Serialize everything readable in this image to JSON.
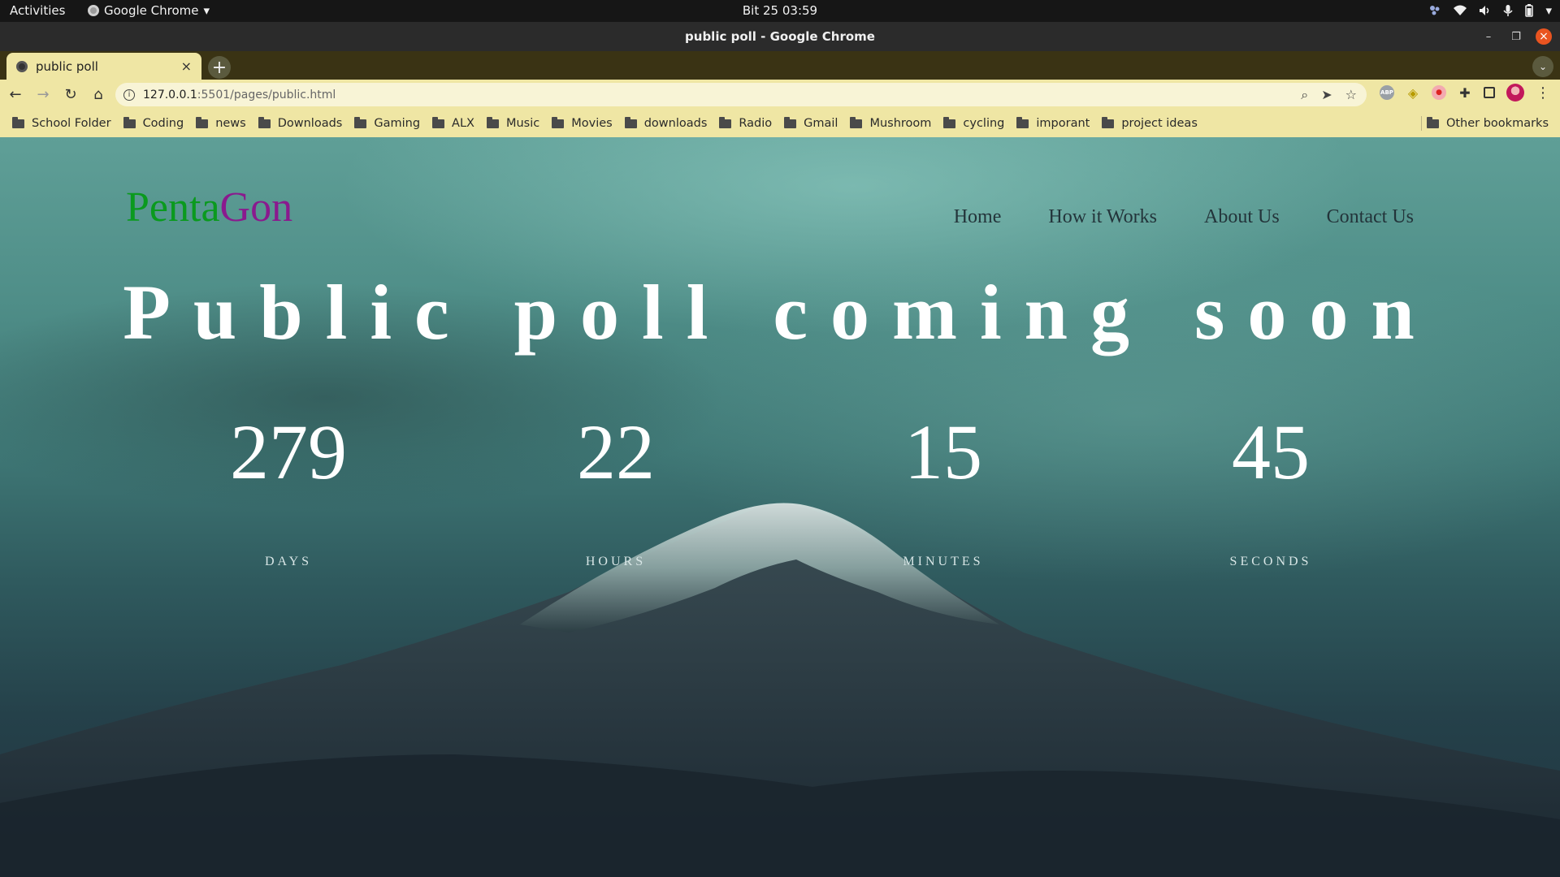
{
  "system_bar": {
    "activities": "Activities",
    "app_name": "Google Chrome",
    "clock": "Bit 25  03:59"
  },
  "window": {
    "title": "public poll - Google Chrome"
  },
  "tabs": [
    {
      "title": "public poll",
      "close": "×"
    }
  ],
  "toolbar": {
    "url_host": "127.0.0.1",
    "url_path": ":5501/pages/public.html"
  },
  "bookmarks": [
    {
      "label": "School Folder"
    },
    {
      "label": "Coding"
    },
    {
      "label": "news"
    },
    {
      "label": "Downloads"
    },
    {
      "label": "Gaming"
    },
    {
      "label": "ALX"
    },
    {
      "label": "Music"
    },
    {
      "label": "Movies"
    },
    {
      "label": "downloads"
    },
    {
      "label": "Radio"
    },
    {
      "label": "Gmail"
    },
    {
      "label": "Mushroom"
    },
    {
      "label": "cycling"
    },
    {
      "label": "imporant"
    },
    {
      "label": "project ideas"
    }
  ],
  "other_bookmarks": "Other bookmarks",
  "site": {
    "logo_part1": "Penta",
    "logo_part2": "Gon",
    "logo_colors": {
      "part1": "#0a9a1e",
      "part2": "#8a1a8e"
    },
    "nav": [
      "Home",
      "How it Works",
      "About Us",
      "Contact Us"
    ],
    "headline": "Public poll coming soon",
    "countdown": [
      {
        "value": "279",
        "label": "DAYS"
      },
      {
        "value": "22",
        "label": "HOURS"
      },
      {
        "value": "15",
        "label": "MINUTES"
      },
      {
        "value": "45",
        "label": "SECONDS"
      }
    ]
  }
}
